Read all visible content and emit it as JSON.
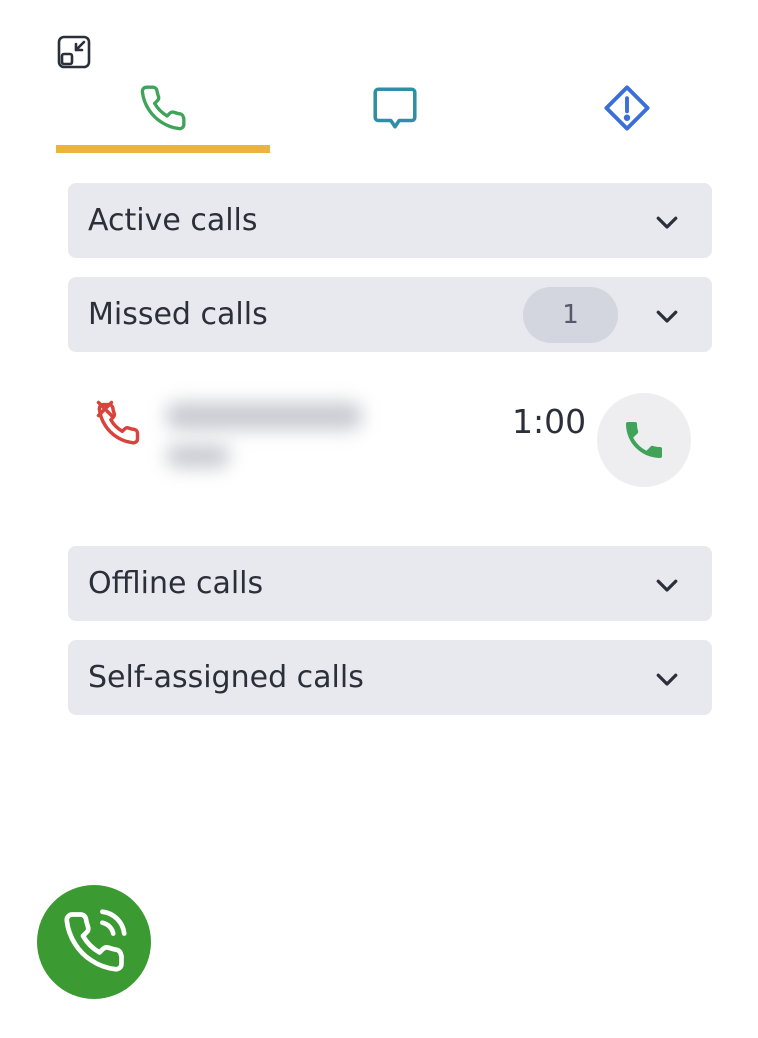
{
  "toolbar": {
    "minimize_icon": "minimize-window-icon"
  },
  "tabs": [
    {
      "id": "calls",
      "icon": "phone-icon",
      "color": "#3fa35a",
      "active": true
    },
    {
      "id": "chat",
      "icon": "chat-bubble-icon",
      "color": "#2f8ea6",
      "active": false
    },
    {
      "id": "alerts",
      "icon": "warning-diamond-icon",
      "color": "#3a6fd9",
      "active": false
    }
  ],
  "active_tab_underline_color": "#ebb43a",
  "sections": {
    "active": {
      "label": "Active calls"
    },
    "missed": {
      "label": "Missed calls",
      "count": "1",
      "items": [
        {
          "caller": "",
          "duration": "1:00",
          "status_icon": "missed-call-icon",
          "status_color": "#d9433b",
          "action_icon": "phone-icon"
        }
      ]
    },
    "offline": {
      "label": "Offline calls"
    },
    "self_assigned": {
      "label": "Self-assigned calls"
    }
  },
  "fab": {
    "icon": "phone-ringing-icon",
    "color": "#3c9a33"
  }
}
